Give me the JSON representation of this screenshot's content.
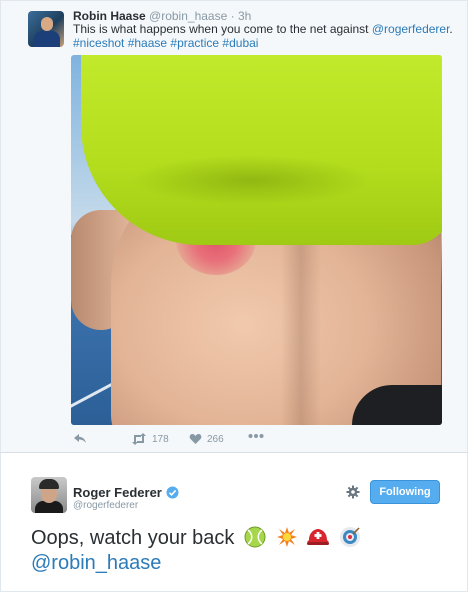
{
  "tweet1": {
    "author_name": "Robin Haase",
    "author_handle": "@robin_haase",
    "separator": "·",
    "time": "3h",
    "text_before": "This is what happens when you come to the net against ",
    "mention": "@rogerfederer",
    "text_after": ".",
    "hashtags": "#niceshot #haase #practice #dubai",
    "actions": {
      "reply_icon": "reply-icon",
      "retweet_icon": "retweet-icon",
      "retweets": "178",
      "like_icon": "heart-icon",
      "likes": "266",
      "more_icon": "more-icon"
    }
  },
  "tweet2": {
    "author_name": "Roger Federer",
    "verified_icon": "verified-badge-icon",
    "author_handle": "@rogerfederer",
    "settings_icon": "gear-icon",
    "follow_label": "Following",
    "text": "Oops, watch your back",
    "emojis": [
      "tennis-ball-icon",
      "collision-icon",
      "swiss-helmet-icon",
      "target-icon"
    ],
    "mention": "@robin_haase"
  },
  "colors": {
    "link": "#2b7bb9",
    "follow_button": "#55acee",
    "meta_gray": "#8899a6"
  }
}
